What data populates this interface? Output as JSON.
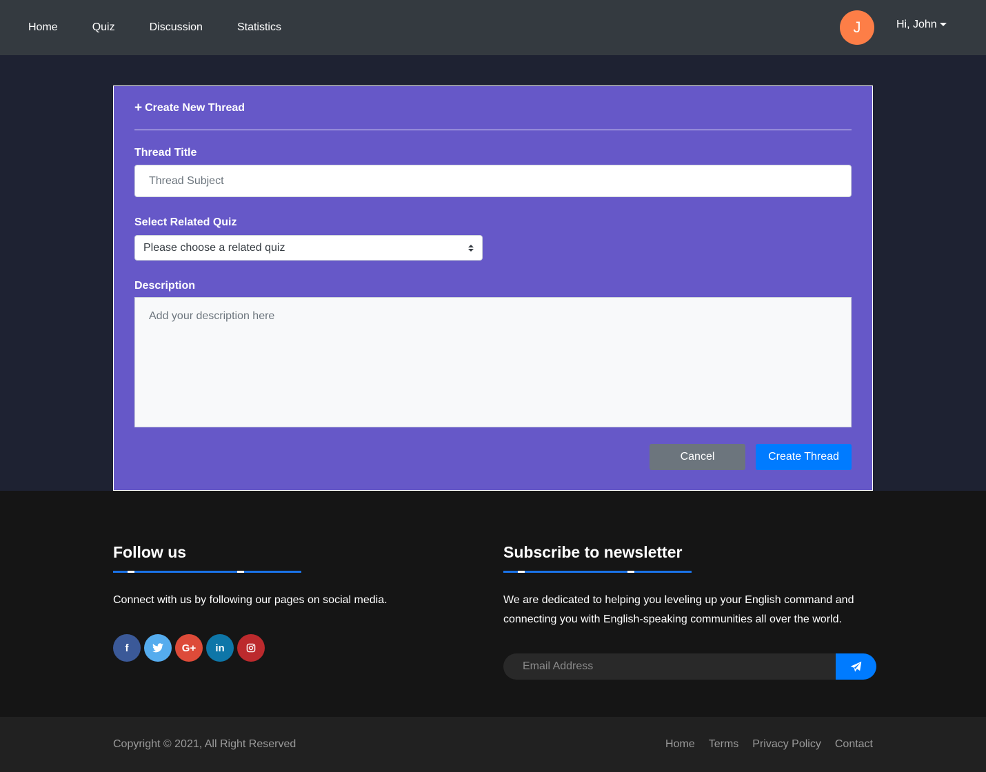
{
  "navbar": {
    "links": [
      "Home",
      "Quiz",
      "Discussion",
      "Statistics"
    ],
    "avatar_initial": "J",
    "user_greeting": "Hi, John"
  },
  "form": {
    "header": "Create New Thread",
    "title_label": "Thread Title",
    "title_placeholder": "Thread Subject",
    "quiz_label": "Select Related Quiz",
    "quiz_selected": "Please choose a related quiz",
    "description_label": "Description",
    "description_placeholder": "Add your description here",
    "cancel_label": "Cancel",
    "create_label": "Create Thread"
  },
  "footer": {
    "follow_title": "Follow us",
    "follow_text": "Connect with us by following our pages on social media.",
    "socials": [
      {
        "name": "facebook-icon",
        "glyph": "f",
        "color": "#3b5998"
      },
      {
        "name": "twitter-icon",
        "glyph": "t",
        "color": "#55acee"
      },
      {
        "name": "google-plus-icon",
        "glyph": "G+",
        "color": "#dd4b39"
      },
      {
        "name": "linkedin-icon",
        "glyph": "in",
        "color": "#0e76a8"
      },
      {
        "name": "instagram-icon",
        "glyph": "◎",
        "color": "#bc2a2d"
      }
    ],
    "newsletter_title": "Subscribe to newsletter",
    "newsletter_text": "We are dedicated to helping you leveling up your English command and connecting you with English-speaking communities all over the world.",
    "email_placeholder": "Email Address"
  },
  "bottom": {
    "copyright": "Copyright © 2021, All Right Reserved",
    "links": [
      "Home",
      "Terms",
      "Privacy Policy",
      "Contact"
    ]
  },
  "colors": {
    "card_bg": "#6658c8",
    "primary": "#007bff",
    "secondary": "#6c757d",
    "avatar": "#fd7e47"
  }
}
